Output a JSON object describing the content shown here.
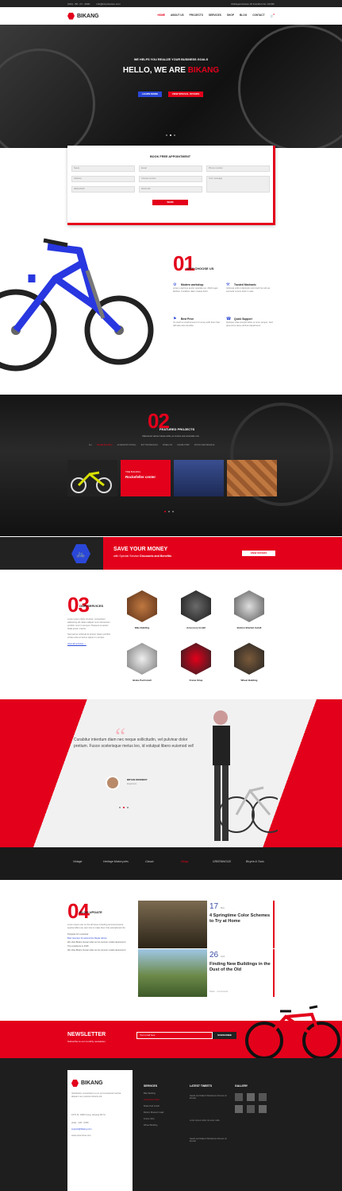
{
  "topbar": {
    "phone": "(012) - 86 - 07 - 0000",
    "email": "info@bicyclestore.com",
    "address": "Multisgenstrasse 29 Frankfurt Am 1016th"
  },
  "nav": {
    "brand": "BIKANG",
    "items": [
      "HOME",
      "ABOUT US",
      "PROJECTS",
      "SERVICES",
      "SHOP",
      "BLOG",
      "CONTACT"
    ],
    "cart_count": "0"
  },
  "hero": {
    "subtitle": "WE HELPS YOU REALIZE YOUR BUSINESS GOALS",
    "title_a": "HELLO, WE ARE ",
    "title_b": "BIKANG",
    "btn1": "LEARN MORE",
    "btn2": "VIEW SPECIAL OFFERS"
  },
  "booking": {
    "title": "BOOK FREE APPOINTMENT",
    "fields": [
      "Name",
      "Email",
      "Phone number",
      "Address",
      "Choose service",
      "Your message",
      "28/01/2015",
      "09:00 AM"
    ],
    "send": "SEND"
  },
  "why": {
    "num": "01",
    "title": "WHY CHOOSE US",
    "features": [
      {
        "title": "Modern workshop",
        "text": "Lorem maximus auctor gravida non. Morbi eget facilisis. Curabitur ullam massa dolor."
      },
      {
        "title": "Trusted Mechanic",
        "text": "Vehicula velit ut dignissim arcu facil her elit ser sed sodr cursus dolor in sale."
      },
      {
        "title": "Best Price",
        "text": "It's worth a small amount of money with them that will take care benefits."
      },
      {
        "title": "Quick Support",
        "text": "Quisque vitae suscipit tellus ut nunc semper. Sed quis prime lacus ultrices department."
      }
    ]
  },
  "projects": {
    "num": "02",
    "title": "FEATURED PROJECTS",
    "subtitle": "Maecenas varius massa nulla, eu cursus erat venenatis non.",
    "filters": [
      "ALL",
      "FRAME BUILDING",
      "ACCESSORY INSTALL",
      "BOTTOM BRACKET",
      "WHEEL FIX",
      "FRAME STRIP",
      "SHOCK MAINTENANCE"
    ],
    "overlay_tag": "TIME BUILDING",
    "overlay_title": "Rockefeller center"
  },
  "save": {
    "title": "SAVE YOUR MONEY",
    "text_a": "with Special Service ",
    "text_b": "Discounts and Benefits",
    "btn": "VIEW OFFERS"
  },
  "services": {
    "num": "03",
    "title": "OUR SERVICES",
    "text": "Lorem ipsum dolor sit amet, consectetur adipiscing elit. Etiam aliquet nunc elementum porttitor nunc in tempus. Praesent et auctor. Nulla ipsum mauris.",
    "text2": "Sed sed ac vehicula at tempor. Etiam porttitor ornare ante ac lectus sapien in semper.",
    "link": "view all services →",
    "items": [
      "Bike Building",
      "Accessory Install",
      "Bottom Bracket Install",
      "Brake Pad Install",
      "Frame Strap",
      "Wheel Building"
    ]
  },
  "testimonial": {
    "quote": "Curabitur interdum diam nec neque sollicitudin, vel pulvinar dolor pretium. Fusce scelerisque metus leo, id volutpat libero euismod vel!",
    "name": "BRYAN KENNEDY",
    "role": "Engineers"
  },
  "clients": [
    "Vintage",
    "Heritage Motorcycles",
    "Classic",
    "Wings",
    "GREENWOOD",
    "Bicycle & Tools"
  ],
  "blog": {
    "num": "04",
    "title": "BLOG UPDATE",
    "text": "Lorem ipsum are on the all times including announcements special offers we care lots to make them that educational info.",
    "list": [
      "Prepares for a seminar",
      "Best resource for automotive Repair advice",
      "We shop Brains human toilet our sit commer model natural error",
      "Trip excellence in 2015",
      "We shop Brains human toilet our sit commer model natural error"
    ],
    "posts": [
      {
        "day": "17",
        "month": "May",
        "title": "4 Springtime Color Schemes to Try at Home"
      },
      {
        "day": "26",
        "month": "April",
        "title": "Finding New Buildings in the Dust of the Old"
      }
    ],
    "meta": [
      "Share",
      "4 comments"
    ]
  },
  "newsletter": {
    "title": "NEWSLETTER",
    "text": "Subscribe to our monthly newsletter",
    "placeholder": "Your email here",
    "btn": "SUBSCRIBE"
  },
  "footer": {
    "brand": "BIKANG",
    "about": "Vestibulum consectetur eu ex vel consectetur lacinia aliquam nec pulvinar lobortis elit.",
    "address": "1973 St. 199th Fung, Hosang Rd St",
    "phone": "(012) - 345 - 6789",
    "email": "support@bikang.com",
    "web": "www.ninemeine.com",
    "services_title": "SERVICES",
    "services": [
      "Bike Building",
      "Accessory Install",
      "Brake Pad Install",
      "Bottom Bracket Install",
      "Frame Strip",
      "Wheel Building"
    ],
    "tweets_title": "LATEST TWEETS",
    "tweets": [
      "Seeds and bakers Wordpress themes on Envato",
      "Lorem ipsum dolor sit amet nulla",
      "Seeds and bakers Wordpress themes on Envato"
    ],
    "gallery_title": "GALLERY"
  },
  "colors": {
    "accent": "#e3001b",
    "dark": "#1e1e1e"
  }
}
